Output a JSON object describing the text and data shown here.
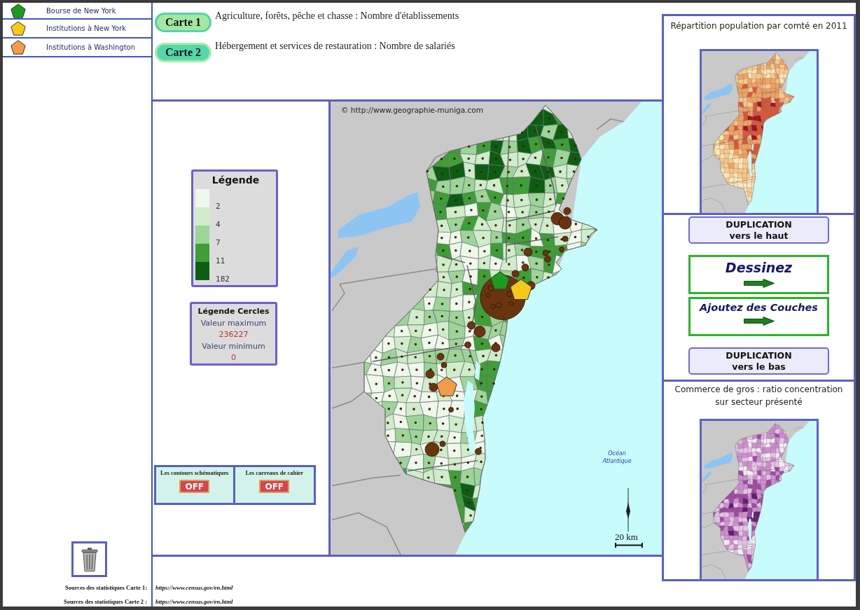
{
  "sidebar": {
    "items": [
      {
        "label": "Bourse de New York",
        "color": "#1e9a1e"
      },
      {
        "label": "Institutions à New York",
        "color": "#f6c81a"
      },
      {
        "label": "Institutions à Washington",
        "color": "#f39c4a"
      }
    ]
  },
  "maps": [
    {
      "kind": "choropleth",
      "button": "Carte 1",
      "title": "Agriculture, forêts, pêche et chasse : Nombre d'établissements"
    },
    {
      "kind": "circles",
      "button": "Carte 2",
      "title": "Hébergement et services de restauration : Nombre de salariés"
    }
  ],
  "legend": {
    "title": "Légende",
    "classes": [
      {
        "label": "2",
        "color": "#eef8ec"
      },
      {
        "label": "4",
        "color": "#cfeccb"
      },
      {
        "label": "7",
        "color": "#9dd49a"
      },
      {
        "label": "11",
        "color": "#3e9f38"
      },
      {
        "label": "182",
        "color": "#0b5e12"
      }
    ]
  },
  "circle_legend": {
    "title": "Légende Cercles",
    "max_label": "Valeur maximum",
    "max_value": "236227",
    "min_label": "Valeur minimum",
    "min_value": "0"
  },
  "toggles": [
    {
      "label": "Les contours schématiques",
      "on": false,
      "state_label": "OFF"
    },
    {
      "label": "Les carreaux de cahier",
      "on": false,
      "state_label": "OFF"
    }
  ],
  "map": {
    "credit": "© http://www.geographie-muniga.com",
    "ocean_label": "Océan Atlantique",
    "scale_label": "20 km"
  },
  "right_panel": {
    "upper_map": {
      "kind": "population",
      "title": "Répartition population par comté en 2011"
    },
    "actions": [
      {
        "kind": "duplicate",
        "title": "DUPLICATION",
        "subtitle": "vers le haut"
      },
      {
        "kind": "draw",
        "title": "Dessinez"
      },
      {
        "kind": "draw",
        "title": "Ajoutez des Couches"
      },
      {
        "kind": "duplicate",
        "title": "DUPLICATION",
        "subtitle": "vers le bas"
      }
    ],
    "lower_map": {
      "kind": "ratio",
      "title": "Commerce de gros : ratio concentration sur secteur présenté"
    }
  },
  "sources": [
    {
      "label": "Sources des statistiques Carte 1:",
      "url": "https://www.census.gov/en.html"
    },
    {
      "label": "Sources des statistiques Carte 2 :",
      "url": "https://www.census.gov/en.html"
    }
  ]
}
